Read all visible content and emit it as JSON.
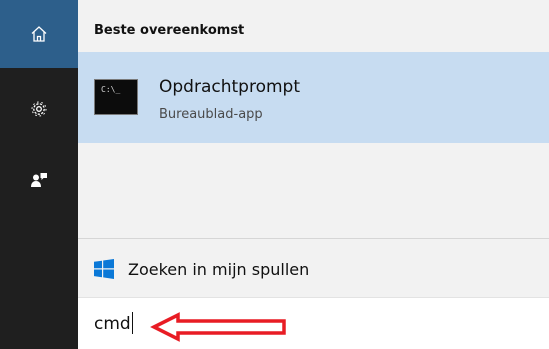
{
  "sidebar": {
    "items": [
      {
        "icon": "home-icon",
        "active": true
      },
      {
        "icon": "gear-icon",
        "active": false
      },
      {
        "icon": "feedback-icon",
        "active": false
      }
    ]
  },
  "results": {
    "section_title": "Beste overeenkomst",
    "best_match": {
      "icon": "command-prompt-icon",
      "icon_text": "C:\\_",
      "name": "Opdrachtprompt",
      "subtitle": "Bureaublad-app"
    },
    "search_mine": {
      "icon": "windows-logo-icon",
      "label": "Zoeken in mijn spullen"
    }
  },
  "searchbar": {
    "query": "cmd"
  },
  "annotation": {
    "arrow_color": "#e81c24"
  },
  "colors": {
    "sidebar_bg": "#1f1f1f",
    "sidebar_active": "#2d5f8b",
    "selection": "#c7dcf1",
    "panel_bg": "#f2f2f2",
    "windows_blue": "#0a78d7"
  }
}
